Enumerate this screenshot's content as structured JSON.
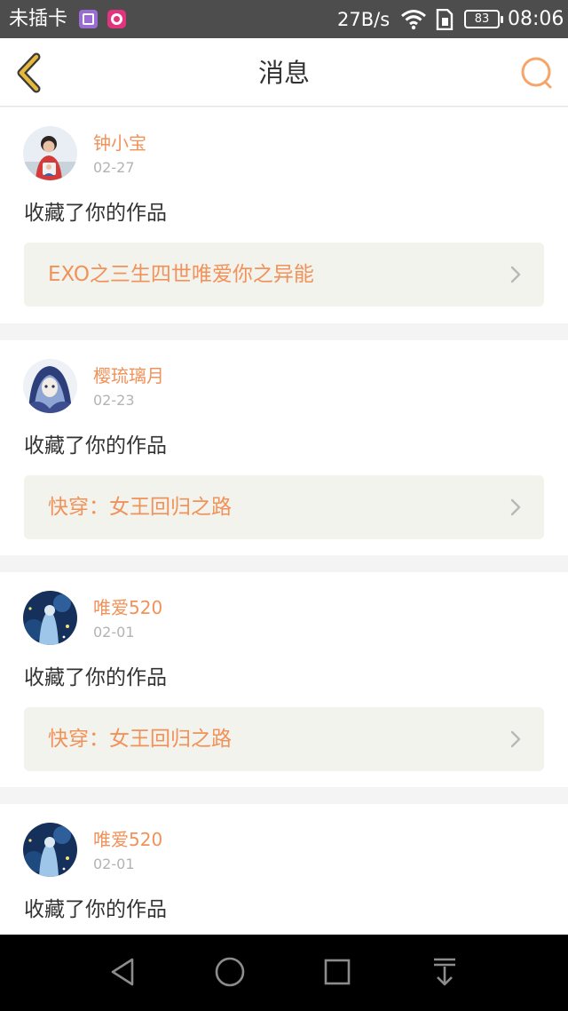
{
  "status_bar": {
    "carrier": "未插卡",
    "net_speed": "27B/s",
    "battery": "83",
    "time": "08:06",
    "icons": [
      "gallery-app-icon",
      "camera-app-icon",
      "wifi-icon",
      "sim-icon",
      "battery-icon"
    ]
  },
  "header": {
    "title": "消息",
    "back_icon": "chevron-left-icon",
    "search_icon": "search-icon"
  },
  "colors": {
    "accent": "#f0925a",
    "back_arrow": "#e6b93a",
    "text": "#333333",
    "muted": "#b3b3b3",
    "card_link_bg": "#f3f3ed",
    "page_bg": "#f4f4f4"
  },
  "messages": [
    {
      "user": "钟小宝",
      "date": "02-27",
      "action": "收藏了你的作品",
      "work": "EXO之三生四世唯爱你之异能"
    },
    {
      "user": "樱琉璃月",
      "date": "02-23",
      "action": "收藏了你的作品",
      "work": "快穿：女王回归之路"
    },
    {
      "user": "唯爱520",
      "date": "02-01",
      "action": "收藏了你的作品",
      "work": "快穿：女王回归之路"
    },
    {
      "user": "唯爱520",
      "date": "02-01",
      "action": "收藏了你的作品",
      "work": ""
    }
  ],
  "nav_bar": {
    "icons": [
      "back-triangle-icon",
      "home-circle-icon",
      "recents-square-icon",
      "notification-pulldown-icon"
    ]
  }
}
